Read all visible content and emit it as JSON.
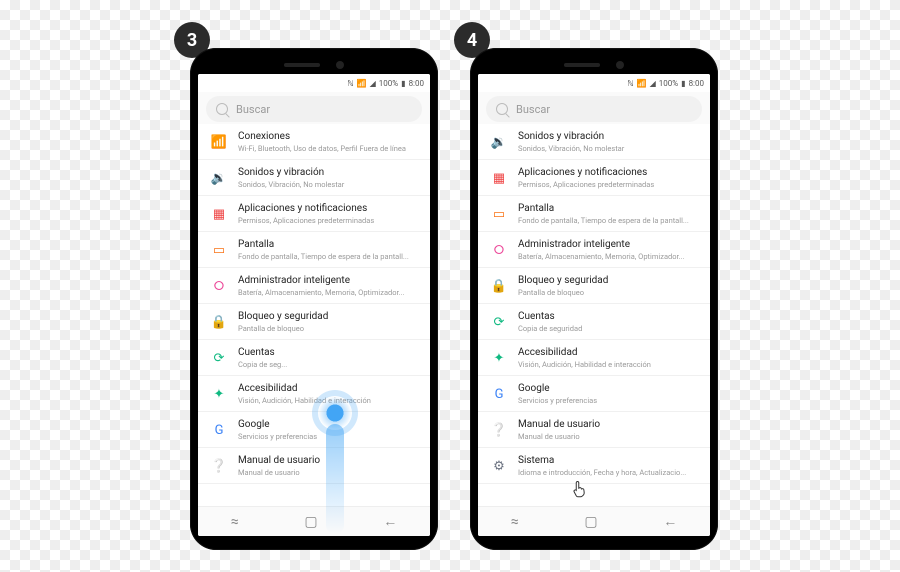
{
  "steps": {
    "left": "3",
    "right": "4"
  },
  "statusbar": {
    "signal": "100%",
    "time": "8:00"
  },
  "search": {
    "placeholder": "Buscar"
  },
  "navbar": {
    "recent": "≈",
    "home": "▢",
    "back": "←"
  },
  "phone_left": {
    "items": [
      {
        "icon": "wifi-icon",
        "glyph": "📶",
        "cls": "c-blue",
        "title": "Conexiones",
        "sub": "Wi-Fi, Bluetooth, Uso de datos, Perfil Fuera de línea"
      },
      {
        "icon": "sound-icon",
        "glyph": "🔉",
        "cls": "c-teal",
        "title": "Sonidos y vibración",
        "sub": "Sonidos, Vibración, No molestar"
      },
      {
        "icon": "apps-icon",
        "glyph": "▦",
        "cls": "c-red",
        "title": "Aplicaciones y notificaciones",
        "sub": "Permisos, Aplicaciones predeterminadas"
      },
      {
        "icon": "display-icon",
        "glyph": "▭",
        "cls": "c-orange",
        "title": "Pantalla",
        "sub": "Fondo de pantalla, Tiempo de espera de la pantall..."
      },
      {
        "icon": "smart-icon",
        "glyph": "⭘",
        "cls": "c-pink",
        "title": "Administrador inteligente",
        "sub": "Batería, Almacenamiento, Memoria, Optimizador..."
      },
      {
        "icon": "lock-icon",
        "glyph": "🔒",
        "cls": "c-blue",
        "title": "Bloqueo y seguridad",
        "sub": "Pantalla de bloqueo"
      },
      {
        "icon": "accounts-icon",
        "glyph": "⟳",
        "cls": "c-green",
        "title": "Cuentas",
        "sub": "Copia de seg..."
      },
      {
        "icon": "a11y-icon",
        "glyph": "✦",
        "cls": "c-green",
        "title": "Accesibilidad",
        "sub": "Visión, Audición, Habilidad e interacción"
      },
      {
        "icon": "google-icon",
        "glyph": "G",
        "cls": "c-blue",
        "title": "Google",
        "sub": "Servicios y preferencias"
      },
      {
        "icon": "manual-icon",
        "glyph": "❔",
        "cls": "c-gray",
        "title": "Manual de usuario",
        "sub": "Manual de usuario"
      }
    ]
  },
  "phone_right": {
    "items": [
      {
        "icon": "sound-icon",
        "glyph": "🔉",
        "cls": "c-teal",
        "title": "Sonidos y vibración",
        "sub": "Sonidos, Vibración, No molestar"
      },
      {
        "icon": "apps-icon",
        "glyph": "▦",
        "cls": "c-red",
        "title": "Aplicaciones y notificaciones",
        "sub": "Permisos, Aplicaciones predeterminadas"
      },
      {
        "icon": "display-icon",
        "glyph": "▭",
        "cls": "c-orange",
        "title": "Pantalla",
        "sub": "Fondo de pantalla, Tiempo de espera de la pantall..."
      },
      {
        "icon": "smart-icon",
        "glyph": "⭘",
        "cls": "c-pink",
        "title": "Administrador inteligente",
        "sub": "Batería, Almacenamiento, Memoria, Optimizador..."
      },
      {
        "icon": "lock-icon",
        "glyph": "🔒",
        "cls": "c-blue",
        "title": "Bloqueo y seguridad",
        "sub": "Pantalla de bloqueo"
      },
      {
        "icon": "accounts-icon",
        "glyph": "⟳",
        "cls": "c-green",
        "title": "Cuentas",
        "sub": "Copia de seguridad"
      },
      {
        "icon": "a11y-icon",
        "glyph": "✦",
        "cls": "c-green",
        "title": "Accesibilidad",
        "sub": "Visión, Audición, Habilidad e interacción"
      },
      {
        "icon": "google-icon",
        "glyph": "G",
        "cls": "c-blue",
        "title": "Google",
        "sub": "Servicios y preferencias"
      },
      {
        "icon": "manual-icon",
        "glyph": "❔",
        "cls": "c-gray",
        "title": "Manual de usuario",
        "sub": "Manual de usuario"
      },
      {
        "icon": "system-icon",
        "glyph": "⚙",
        "cls": "c-gray",
        "title": "Sistema",
        "sub": "Idioma e introducción, Fecha y hora, Actualizacio..."
      }
    ]
  }
}
